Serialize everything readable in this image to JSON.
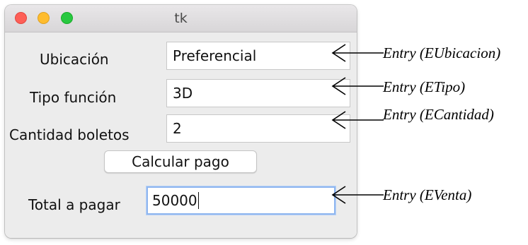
{
  "window": {
    "title": "tk"
  },
  "form": {
    "ubicacion": {
      "label": "Ubicación",
      "value": "Preferencial"
    },
    "tipo": {
      "label": "Tipo función",
      "value": "3D"
    },
    "cantidad": {
      "label": "Cantidad boletos",
      "value": "2"
    },
    "calcular_button": "Calcular pago",
    "total": {
      "label": "Total a pagar",
      "value": "50000"
    }
  },
  "annotations": [
    "Entry (EUbicacion)",
    "Entry (ETipo)",
    "Entry (ECantidad)",
    "Entry (EVenta)"
  ],
  "colors": {
    "close": "#fe5f57",
    "minimize": "#febc2e",
    "zoom": "#28c840",
    "focus_ring": "#8fb6ef"
  }
}
